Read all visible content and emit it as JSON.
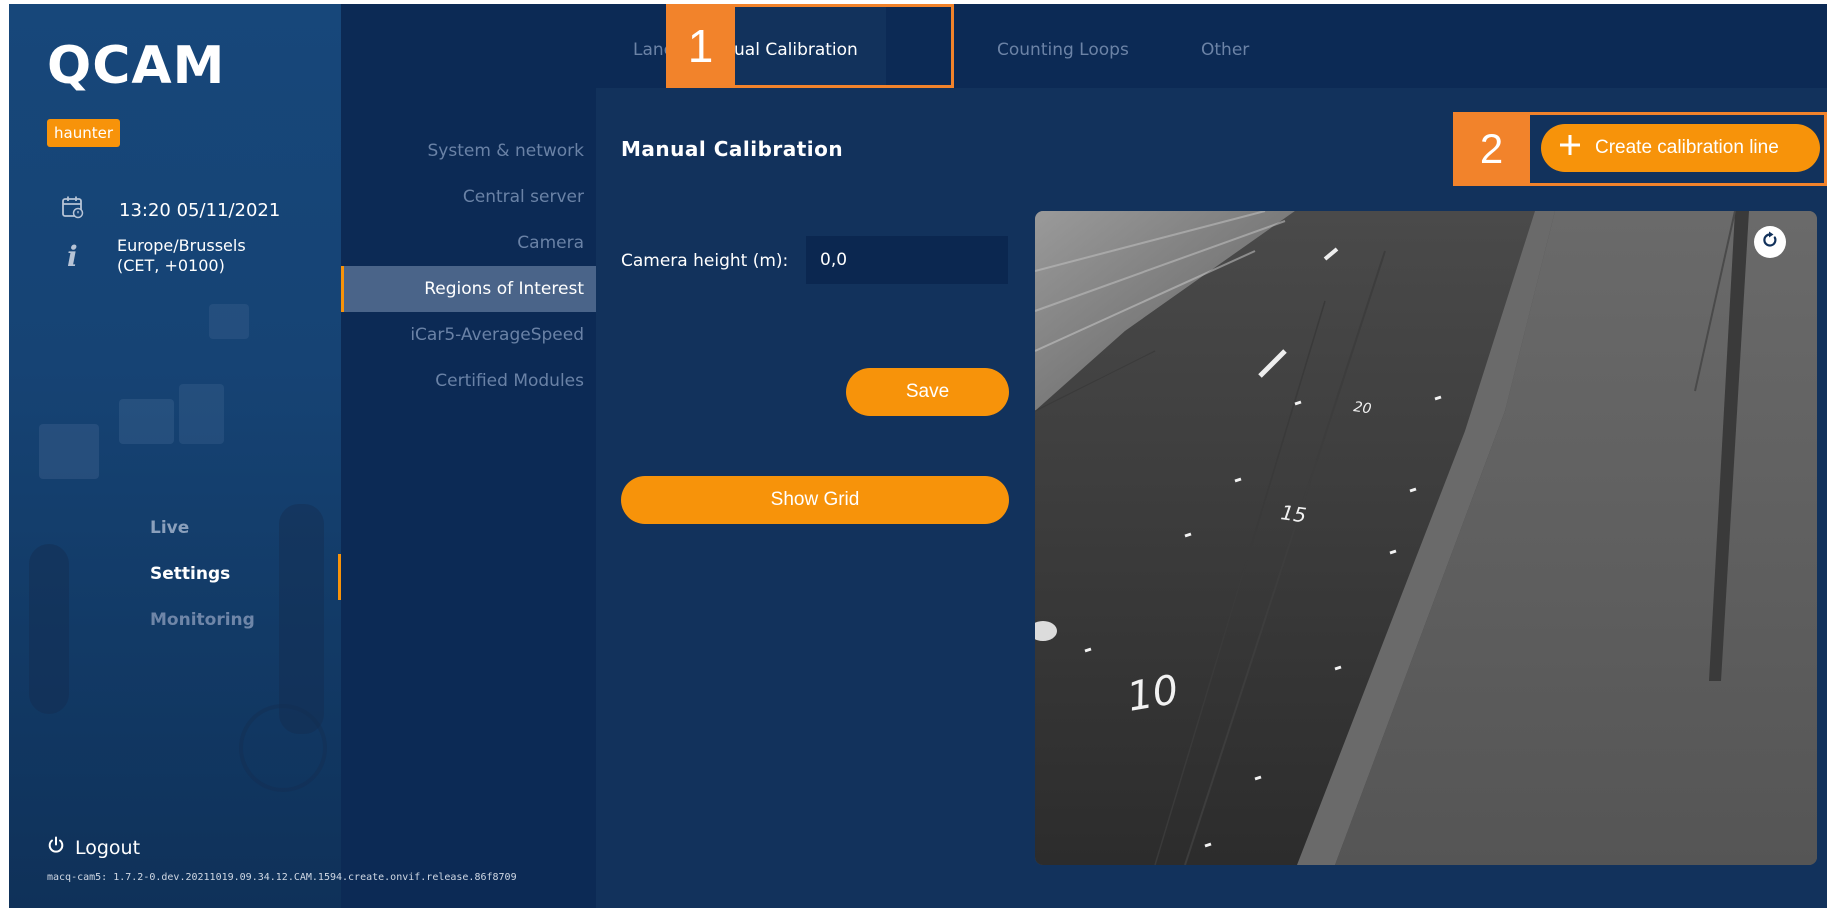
{
  "app": {
    "logo": "QCAM",
    "user": "haunter",
    "datetime": "13:20 05/11/2021",
    "timezone_line1": "Europe/Brussels",
    "timezone_line2": "(CET, +0100)",
    "logout_label": "Logout",
    "version": "macq-cam5: 1.7.2-0.dev.20211019.09.34.12.CAM.1594.create.onvif.release.86f8709"
  },
  "main_nav": [
    {
      "label": "Live",
      "active": false
    },
    {
      "label": "Settings",
      "active": true
    },
    {
      "label": "Monitoring",
      "active": false
    }
  ],
  "settings_nav": [
    {
      "label": "System & network",
      "active": false
    },
    {
      "label": "Central server",
      "active": false
    },
    {
      "label": "Camera",
      "active": false
    },
    {
      "label": "Regions of Interest",
      "active": true
    },
    {
      "label": "iCar5-AverageSpeed",
      "active": false
    },
    {
      "label": "Certified Modules",
      "active": false
    }
  ],
  "tabs": [
    {
      "label": "Lanes",
      "active": false
    },
    {
      "label": "Manual Calibration",
      "active": true
    },
    {
      "label": "Counting Loops",
      "active": false
    },
    {
      "label": "Other",
      "active": false
    }
  ],
  "annotations": {
    "step1": "1",
    "step2": "2"
  },
  "content": {
    "title": "Manual Calibration",
    "camera_height_label": "Camera height (m):",
    "camera_height_value": "0,0",
    "save_label": "Save",
    "show_grid_label": "Show Grid",
    "create_line_label": "Create calibration line"
  },
  "camera_overlay_text": [
    "20",
    "15",
    "10"
  ],
  "colors": {
    "accent": "#f7930a",
    "annotation": "#f2832b",
    "panel_bg": "#12325c",
    "nav_bg": "#0c2a55",
    "sidebar_bg": "#164374"
  },
  "icons": {
    "calendar": "calendar-icon",
    "info": "info-icon",
    "power": "power-icon",
    "plus": "plus-icon",
    "refresh": "refresh-icon"
  }
}
